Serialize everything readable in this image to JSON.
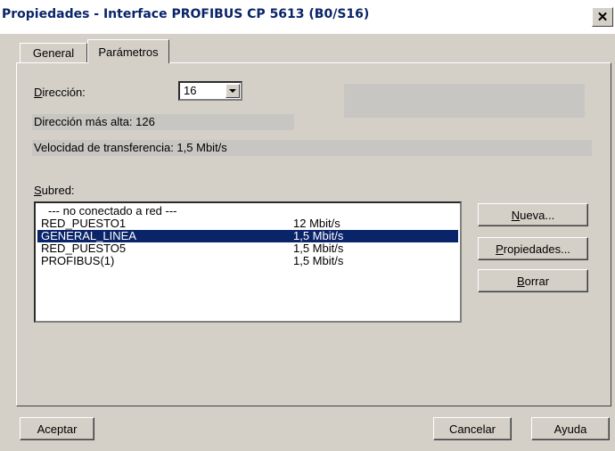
{
  "window": {
    "title": "Propiedades - Interface PROFIBUS  CP 5613 (B0/S16)",
    "close": "✕"
  },
  "tabs": [
    {
      "label": "General"
    },
    {
      "label": "Parámetros"
    }
  ],
  "params": {
    "direccion_first": "D",
    "direccion_rest": "irección:",
    "direccion_value": "16",
    "dir_alta": "Dirección más alta:  126",
    "velocidad": "Velocidad de transferencia: 1,5 Mbit/s",
    "subred_first": "S",
    "subred_rest": "ubred:"
  },
  "subnet_list": {
    "header": "--- no conectado a red ---",
    "rows": [
      {
        "name": "RED_PUESTO1",
        "speed": "12 Mbit/s"
      },
      {
        "name": "GENERAL_LINEA",
        "speed": "1,5 Mbit/s"
      },
      {
        "name": "RED_PUESTO5",
        "speed": "1,5 Mbit/s"
      },
      {
        "name": "PROFIBUS(1)",
        "speed": "1,5 Mbit/s"
      }
    ],
    "selected_index": 1
  },
  "side_buttons": {
    "nueva_first": "N",
    "nueva_rest": "ueva...",
    "prop_first": "P",
    "prop_rest": "ropiedades...",
    "borrar_first": "B",
    "borrar_rest": "orrar"
  },
  "footer": {
    "aceptar": "Aceptar",
    "cancelar": "Cancelar",
    "ayuda": "Ayuda"
  }
}
